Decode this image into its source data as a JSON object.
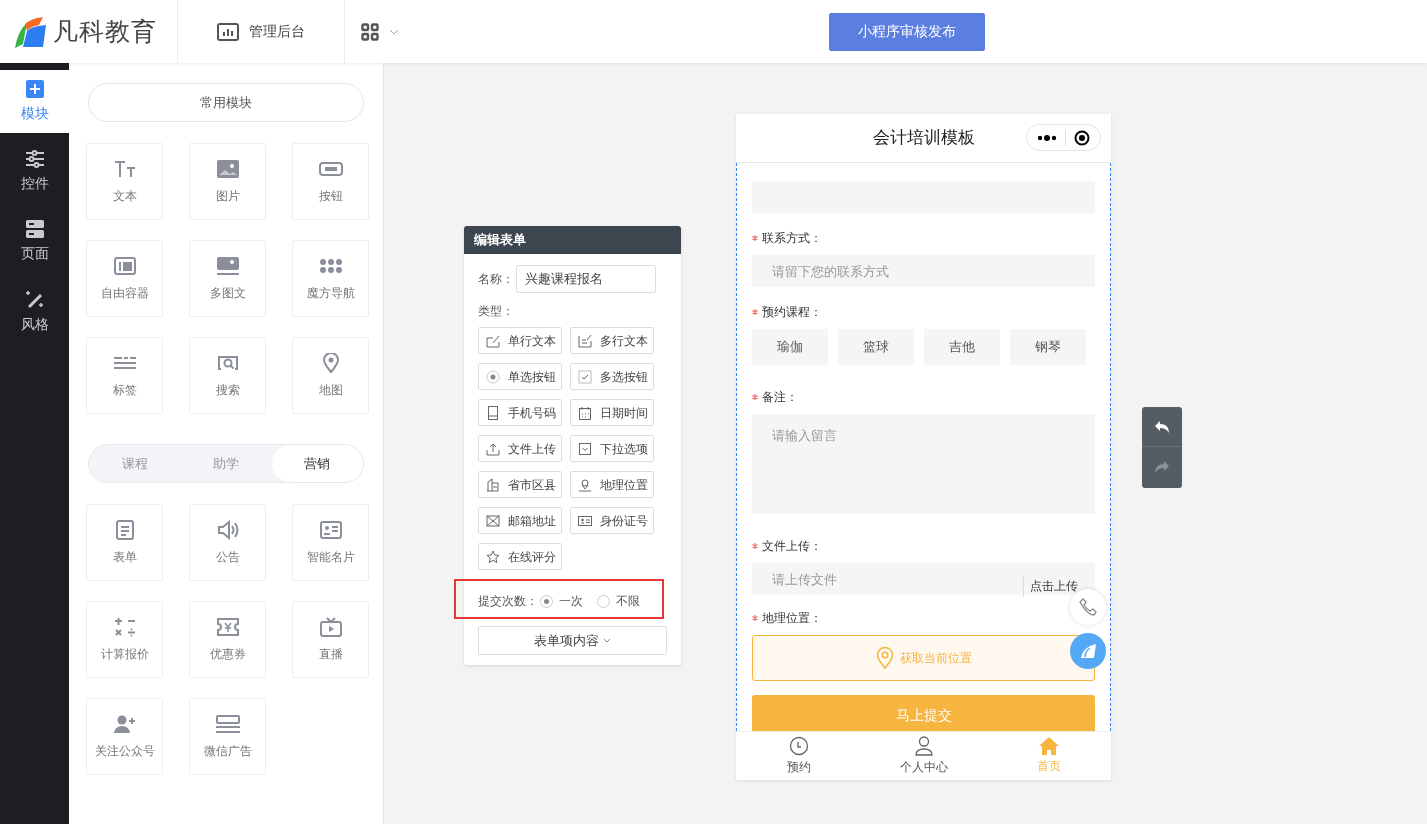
{
  "header": {
    "logo": "凡科教育",
    "nav": [
      {
        "label": "管理后台"
      }
    ],
    "publish_button": "小程序审核发布"
  },
  "sidebar": {
    "items": [
      {
        "label": "模块",
        "selected": true
      },
      {
        "label": "控件",
        "selected": false
      },
      {
        "label": "页面",
        "selected": false
      },
      {
        "label": "风格",
        "selected": false
      }
    ]
  },
  "module_panel": {
    "common_title": "常用模块",
    "common": [
      {
        "label": "文本"
      },
      {
        "label": "图片"
      },
      {
        "label": "按钮"
      },
      {
        "label": "自由容器"
      },
      {
        "label": "多图文"
      },
      {
        "label": "魔方导航"
      },
      {
        "label": "标签"
      },
      {
        "label": "搜索"
      },
      {
        "label": "地图"
      }
    ],
    "tabs": [
      {
        "label": "课程",
        "selected": false
      },
      {
        "label": "助学",
        "selected": false
      },
      {
        "label": "营销",
        "selected": true
      }
    ],
    "marketing": [
      {
        "label": "表单"
      },
      {
        "label": "公告"
      },
      {
        "label": "智能名片"
      },
      {
        "label": "计算报价"
      },
      {
        "label": "优惠券"
      },
      {
        "label": "直播"
      },
      {
        "label": "关注公众号"
      },
      {
        "label": "微信广告"
      }
    ]
  },
  "edit_form": {
    "title": "编辑表单",
    "name_label": "名称：",
    "name_value": "兴趣课程报名",
    "type_label": "类型：",
    "types": [
      {
        "label": "单行文本"
      },
      {
        "label": "多行文本"
      },
      {
        "label": "单选按钮"
      },
      {
        "label": "多选按钮"
      },
      {
        "label": "手机号码"
      },
      {
        "label": "日期时间"
      },
      {
        "label": "文件上传"
      },
      {
        "label": "下拉选项"
      },
      {
        "label": "省市区县"
      },
      {
        "label": "地理位置"
      },
      {
        "label": "邮箱地址"
      },
      {
        "label": "身份证号"
      },
      {
        "label": "在线评分"
      }
    ],
    "submit_count": {
      "label": "提交次数：",
      "highlighted": true,
      "options": [
        {
          "label": "一次",
          "selected": true
        },
        {
          "label": "不限",
          "selected": false
        }
      ]
    },
    "items_button": "表单项内容"
  },
  "phone": {
    "title": "会计培训模板",
    "fields": [
      {
        "kind": "input"
      },
      {
        "kind": "input",
        "label": "联系方式：",
        "required": true,
        "placeholder": "请留下您的联系方式"
      },
      {
        "kind": "choices",
        "label": "预约课程：",
        "required": true,
        "options": [
          "瑜伽",
          "篮球",
          "吉他",
          "钢琴"
        ]
      },
      {
        "kind": "textarea",
        "label": "备注：",
        "required": true,
        "placeholder": "请输入留言"
      },
      {
        "kind": "upload",
        "label": "文件上传：",
        "required": true,
        "placeholder": "请上传文件",
        "button": "点击上传"
      },
      {
        "kind": "location",
        "label": "地理位置：",
        "required": true,
        "button": "获取当前位置"
      }
    ],
    "submit": "马上提交",
    "tabs": [
      {
        "label": "预约",
        "selected": false
      },
      {
        "label": "个人中心",
        "selected": false
      },
      {
        "label": "首页",
        "selected": true
      }
    ]
  }
}
